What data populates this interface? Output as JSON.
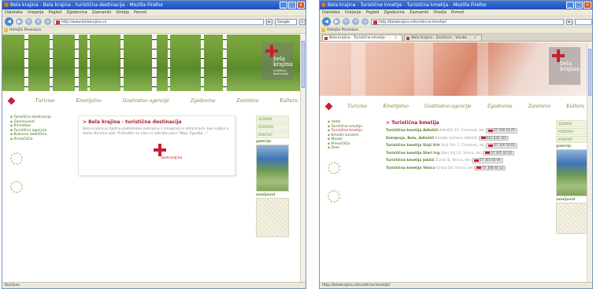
{
  "win1": {
    "title": "Bela krajina - Bela krajina - turistična destinacija - Mozilla Firefox",
    "menu": [
      "Datoteka",
      "Urejanje",
      "Pogled",
      "Zgodovina",
      "Zaznamki",
      "Orodja",
      "Pomoč"
    ],
    "url": "http://www.belakrajina.si/",
    "search_placeholder": "Google",
    "bookmark": "Hitrejša Povezava",
    "nav": [
      "Turizmo",
      "Kmetijstvo",
      "Gostinstvo agencije",
      "Zgodovina",
      "Zanimivo",
      "Kultura"
    ],
    "left_links": [
      "Turistična destinacija",
      "Zanimivosti",
      "Prireditve",
      "Turistične agencije",
      "Kulturna dediščina",
      "Prenočišča"
    ],
    "card_title": "Bela krajina - turistična destinacija",
    "card_text": "Bela krajina je tipično podeželsko pokrajina z vinogradi in zidanicami, kjer vabijo k izletu številne poti. Pridružite se nam in odkrijte sami \"Moje Zgodbe...\"",
    "logo_text": "bela krajina",
    "logo_small": "turistična destinacija",
    "right_boxes": [
      "SEZNAM",
      "POZDRAV",
      "KONTAKT"
    ],
    "right_label_1": "galerija",
    "right_label_2": "zemljevid",
    "status": "Končano"
  },
  "win2": {
    "title": "Bela krajina - Turistične kmetije - Turistična kmetija - Mozilla Firefox",
    "menu": [
      "Datoteka",
      "Urejanje",
      "Pogled",
      "Zgodovina",
      "Zaznamki",
      "Orodja",
      "Pomoč"
    ],
    "url": "http://belakrajina.si/turisticne-kmetije/",
    "bookmark": "Hitrejša Povezava",
    "tabs": [
      {
        "label": "Bela krajina - Turistične kmetije - ..."
      },
      {
        "label": "Bela krajina - Zvočnice - Vinske ..."
      }
    ],
    "nav": [
      "Turizmo",
      "Kmetijstvo",
      "Gostinstvo agencije",
      "Zgodovina",
      "Zanimivo",
      "Kultura"
    ],
    "left_links": [
      "Hotel",
      "Turistične kmetije",
      "Turistične kmetije",
      "Kmečki turizem",
      "Muzeji",
      "Prenočišča",
      "Dom"
    ],
    "section_title": "Turistična kmetija",
    "entries": [
      {
        "name": "Turistična kmetija Adlešiči",
        "text": "Adlešiči 15, Črnomelj, tel.",
        "phone": "07 356 10 25"
      },
      {
        "name": "Dolnjenja, Bela, Adlešiči",
        "text": "Kmečki turizem Adlešiči",
        "phone": "041 635 341"
      },
      {
        "name": "Turistična kmetija Sinji Vrh",
        "text": "Sinji Vrh 7, Črnomelj, tel.",
        "phone": "07 306 56 05"
      },
      {
        "name": "Turistična kmetija Stari trg",
        "text": "Stari trg 22, Vinica, tel.",
        "phone": "07 305 40 20"
      },
      {
        "name": "Turistična kmetija Jakšič",
        "text": "Žuniči 6, Vinica, tel.",
        "phone": "07 305 60 94"
      },
      {
        "name": "Turistična kmetija Vinica",
        "text": "Vinica 50, Vinica, tel.",
        "phone": "07 306 40 12"
      }
    ],
    "right_boxes": [
      "SEZNAM",
      "POZDRAV",
      "KONTAKT"
    ],
    "right_label_1": "galerija",
    "right_label_2": "zemljevid",
    "logo_text": "bela krajina",
    "status": "http://belakrajina.si/turisticne-kmetije/"
  }
}
